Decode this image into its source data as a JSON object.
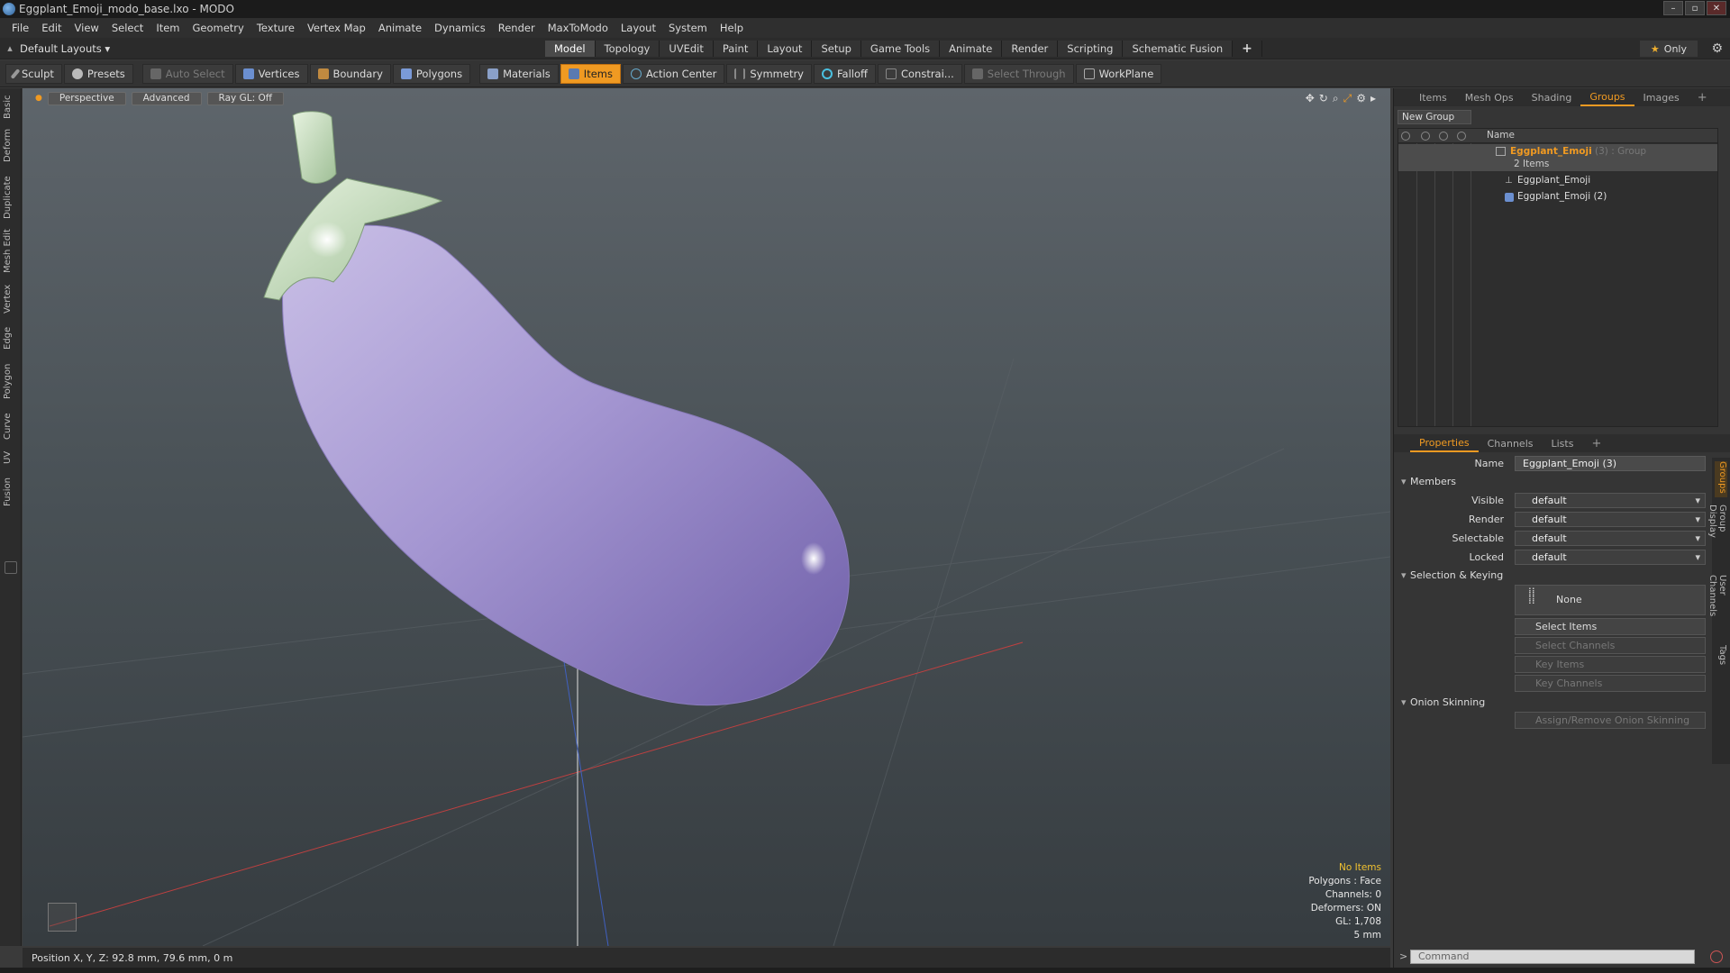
{
  "window": {
    "title": "Eggplant_Emoji_modo_base.lxo - MODO",
    "controls": [
      "–",
      "▫",
      "✕"
    ]
  },
  "menu": [
    "File",
    "Edit",
    "View",
    "Select",
    "Item",
    "Geometry",
    "Texture",
    "Vertex Map",
    "Animate",
    "Dynamics",
    "Render",
    "MaxToModo",
    "Layout",
    "System",
    "Help"
  ],
  "layout": {
    "current": "Default Layouts ▾",
    "tabs": [
      "Model",
      "Topology",
      "UVEdit",
      "Paint",
      "Layout",
      "Setup",
      "Game Tools",
      "Animate",
      "Render",
      "Scripting",
      "Schematic Fusion"
    ],
    "active_tab": "Model",
    "plus": "+",
    "only_label": "Only",
    "star": "★",
    "gear": "⚙"
  },
  "toolbar": {
    "sculpt": "Sculpt",
    "presets": "Presets",
    "auto_select": "Auto Select",
    "vertices": "Vertices",
    "boundary": "Boundary",
    "polygons": "Polygons",
    "materials": "Materials",
    "items": "Items",
    "action_center": "Action Center",
    "symmetry": "Symmetry",
    "falloff": "Falloff",
    "constraints": "Constrai...",
    "select_through": "Select Through",
    "workplane": "WorkPlane"
  },
  "left_tabs": [
    "Basic",
    "Deform",
    "Duplicate",
    "Mesh Edit",
    "Vertex",
    "Edge",
    "Polygon",
    "Curve",
    "UV",
    "Fusion"
  ],
  "viewport": {
    "perspective": "Perspective",
    "advanced": "Advanced",
    "raygl": "Ray GL: Off",
    "stats": {
      "selection": "No Items",
      "polygons": "Polygons : Face",
      "channels": "Channels: 0",
      "deformers": "Deformers: ON",
      "gl": "GL: 1,708",
      "scale": "5 mm"
    },
    "colors": {
      "eggplant": "#9b8ec8",
      "stem": "#c8dfbf",
      "grid_red": "#c04040",
      "grid_blue": "#4060c0"
    }
  },
  "status": {
    "position": "Position X, Y, Z:  92.8 mm, 79.6 mm, 0 m"
  },
  "panel_tabs": {
    "top": [
      "Items",
      "Mesh Ops",
      "Shading",
      "Groups",
      "Images"
    ],
    "top_active": "Groups",
    "bottom": [
      "Properties",
      "Channels",
      "Lists"
    ],
    "bottom_active": "Properties",
    "plus": "+"
  },
  "groups": {
    "new_group": "New Group",
    "name_header": "Name",
    "group_name": "Eggplant_Emoji",
    "group_meta": "(3) : Group",
    "items_count": "2 Items",
    "children": [
      "Eggplant_Emoji",
      "Eggplant_Emoji (2)"
    ]
  },
  "properties": {
    "name_label": "Name",
    "name_value": "Eggplant_Emoji (3)",
    "members_section": "Members",
    "visible_label": "Visible",
    "visible_value": "default",
    "render_label": "Render",
    "render_value": "default",
    "selectable_label": "Selectable",
    "selectable_value": "default",
    "locked_label": "Locked",
    "locked_value": "default",
    "selection_section": "Selection & Keying",
    "none_btn": "None",
    "select_items": "Select Items",
    "select_channels": "Select Channels",
    "key_items": "Key Items",
    "key_channels": "Key Channels",
    "onion_section": "Onion Skinning",
    "assign_onion": "Assign/Remove Onion Skinning"
  },
  "right_vtabs": [
    "Groups",
    "Group Display",
    "User Channels",
    "Tags"
  ],
  "command": {
    "placeholder": "Command",
    "prompt": ">"
  }
}
